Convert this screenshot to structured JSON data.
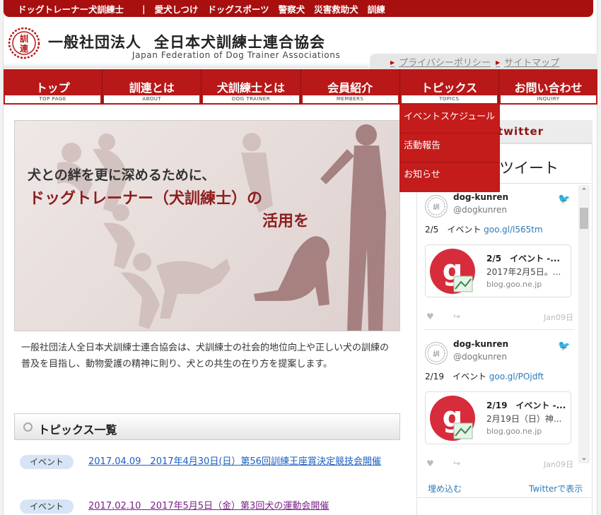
{
  "topbar": {
    "items": [
      "ドッグトレーナー犬訓練士",
      "|",
      "愛犬しつけ",
      "ドッグスポーツ",
      "警察犬",
      "災害救助犬",
      "訓練"
    ]
  },
  "header": {
    "seal_char1": "訓",
    "seal_char2": "連",
    "title_part1": "一般社団法人",
    "title_part2": "全日本犬訓練士連合協会",
    "subtitle": "Japan Federation of Dog Trainer Associations",
    "privacy_link": "プライバシーポリシー",
    "sitemap_link": "サイトマップ"
  },
  "nav": {
    "items": [
      {
        "label": "トップ",
        "en": "TOP PAGE"
      },
      {
        "label": "訓連とは",
        "en": "ABOUT"
      },
      {
        "label": "犬訓練士とは",
        "en": "DOG TRAINER"
      },
      {
        "label": "会員紹介",
        "en": "MEMBERS"
      },
      {
        "label": "トピックス",
        "en": "TOPICS"
      },
      {
        "label": "お問い合わせ",
        "en": "INQUIRY"
      }
    ]
  },
  "dropdown": {
    "items": [
      "イベントスケジュール",
      "活動報告",
      "お知らせ"
    ]
  },
  "hero": {
    "line1": "犬との絆を更に深めるために、",
    "line2": "ドッグトレーナー（犬訓練士）の",
    "line3": "活用を"
  },
  "intro": "一般社団法人全日本犬訓練士連合協会は、犬訓練士の社会的地位向上や正しい犬の訓練の普及を目指し、動物愛護の精神に則り、犬との共生の在り方を提案します。",
  "topics": {
    "heading": "トピックス一覧",
    "items": [
      {
        "badge": "イベント",
        "text": "2017.04.09　2017年4月30日(日）第56回訓練王座賞決定競技会開催",
        "color": "#1a5fc4"
      },
      {
        "badge": "イベント",
        "text": "2017.02.10　2017年5月5日（金）第3回犬の運動会開催",
        "color": "#7a1f8a"
      }
    ]
  },
  "twitter": {
    "head": "twitter",
    "title": "ツイート",
    "tweets": [
      {
        "name": "dog-kunren",
        "handle": "@dogkunren",
        "text": "2/5　イベント",
        "link": "goo.gl/l565tm",
        "card_title": "2/5　イベント -...",
        "card_desc": "2017年2月5日。...",
        "card_domain": "blog.goo.ne.jp",
        "date": "Jan09日"
      },
      {
        "name": "dog-kunren",
        "handle": "@dogkunren",
        "text": "2/19　イベント",
        "link": "goo.gl/POjdft",
        "card_title": "2/19　イベント -...",
        "card_desc": "2月19日（日）神...",
        "card_domain": "blog.goo.ne.jp",
        "date": "Jan09日"
      }
    ],
    "embed_label": "埋め込む",
    "view_label": "Twitterで表示"
  },
  "colors": {
    "brand_red": "#b81818",
    "dark_red": "#a80f0f",
    "accent_text": "#8e1d1d",
    "link_blue": "#1a5fc4",
    "visited_purple": "#7a1f8a"
  }
}
